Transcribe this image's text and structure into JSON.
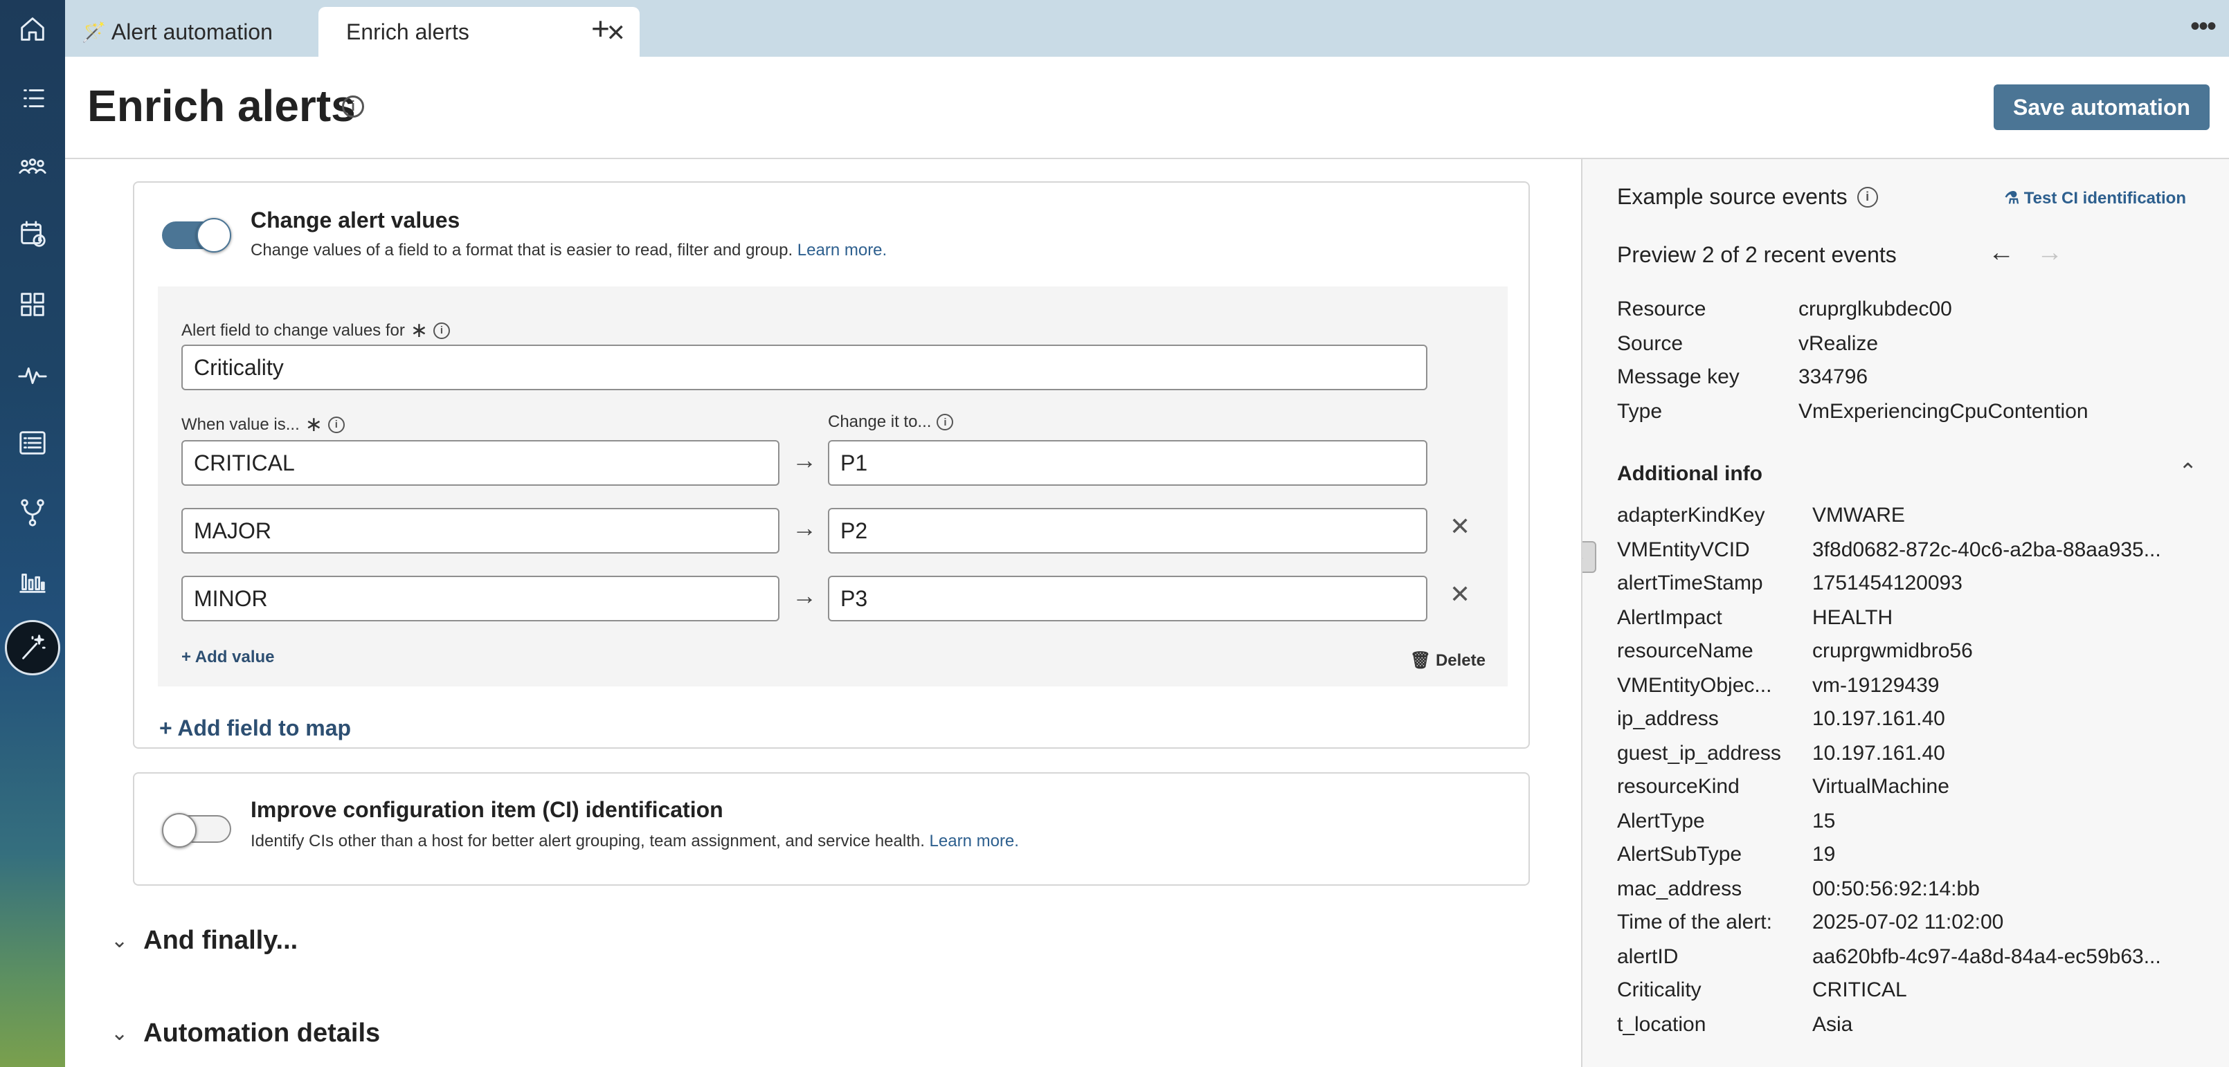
{
  "tabs": [
    {
      "label": "Alert automation",
      "active": false
    },
    {
      "label": "Enrich alerts",
      "active": true
    }
  ],
  "header": {
    "title": "Enrich alerts",
    "save_label": "Save automation"
  },
  "change_values": {
    "title": "Change alert values",
    "description": "Change values of a field to a format that is easier to read, filter and group.",
    "learn_more": "Learn more.",
    "enabled": true,
    "field_label": "Alert field to change values for",
    "field_value": "Criticality",
    "when_label": "When value is...",
    "change_label": "Change it to...",
    "mappings": [
      {
        "from": "CRITICAL",
        "to": "P1"
      },
      {
        "from": "MAJOR",
        "to": "P2"
      },
      {
        "from": "MINOR",
        "to": "P3"
      }
    ],
    "add_value": "Add value",
    "delete": "Delete",
    "add_field": "Add field to map"
  },
  "ci_identification": {
    "title": "Improve configuration item (CI) identification",
    "description": "Identify CIs other than a host for better alert grouping, team assignment, and service health.",
    "learn_more": "Learn more.",
    "enabled": false
  },
  "sections": [
    {
      "label": "And finally..."
    },
    {
      "label": "Automation details"
    }
  ],
  "panel": {
    "title": "Example source events",
    "test_link": "Test CI identification",
    "preview": "Preview 2 of 2 recent events",
    "fields": [
      {
        "key": "Resource",
        "value": "cruprglkubdec00"
      },
      {
        "key": "Source",
        "value": "vRealize"
      },
      {
        "key": "Message key",
        "value": "334796"
      },
      {
        "key": "Type",
        "value": "VmExperiencingCpuContention"
      }
    ],
    "additional_title": "Additional info",
    "additional": [
      {
        "key": "adapterKindKey",
        "value": "VMWARE"
      },
      {
        "key": "VMEntityVCID",
        "value": "3f8d0682-872c-40c6-a2ba-88aa935..."
      },
      {
        "key": "alertTimeStamp",
        "value": "1751454120093"
      },
      {
        "key": "AlertImpact",
        "value": "HEALTH"
      },
      {
        "key": "resourceName",
        "value": "cruprgwmidbro56"
      },
      {
        "key": "VMEntityObjec...",
        "value": "vm-19129439"
      },
      {
        "key": "ip_address",
        "value": "10.197.161.40"
      },
      {
        "key": "guest_ip_address",
        "value": "10.197.161.40"
      },
      {
        "key": "resourceKind",
        "value": "VirtualMachine"
      },
      {
        "key": "AlertType",
        "value": "15"
      },
      {
        "key": "AlertSubType",
        "value": "19"
      },
      {
        "key": "mac_address",
        "value": "00:50:56:92:14:bb"
      },
      {
        "key": "Time of the alert:",
        "value": "2025-07-02 11:02:00"
      },
      {
        "key": "alertID",
        "value": "aa620bfb-4c97-4a8d-84a4-ec59b63..."
      },
      {
        "key": "Criticality",
        "value": "CRITICAL"
      },
      {
        "key": "t_location",
        "value": "Asia"
      }
    ]
  },
  "colors": {
    "accent": "#4b7595",
    "link": "#2d5f8e",
    "tabbar": "#c9dbe6"
  }
}
